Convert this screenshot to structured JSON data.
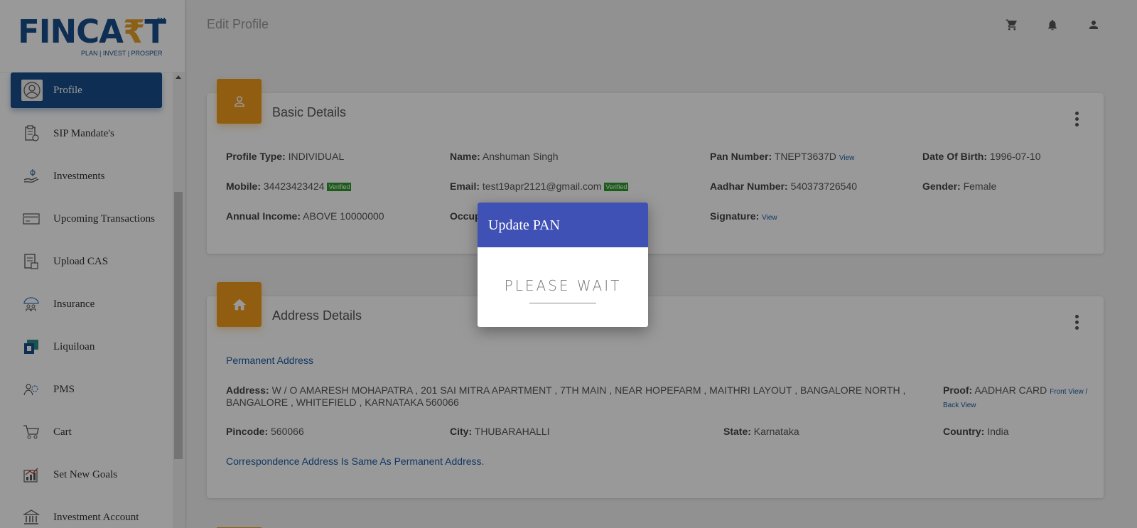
{
  "brand": {
    "name_pre": "FINCA",
    "name_rupee": "₹",
    "name_post": "T",
    "tm": "TM",
    "tagline": "PLAN | INVEST | PROSPER"
  },
  "sidebar": {
    "items": [
      {
        "label": "Profile",
        "icon": "user-circle-icon",
        "active": true
      },
      {
        "label": "SIP Mandate's",
        "icon": "clipboard-icon"
      },
      {
        "label": "Investments",
        "icon": "hand-money-icon"
      },
      {
        "label": "Upcoming Transactions",
        "icon": "card-icon"
      },
      {
        "label": "Upload CAS",
        "icon": "document-upload-icon"
      },
      {
        "label": "Insurance",
        "icon": "umbrella-family-icon"
      },
      {
        "label": "Liquiloan",
        "icon": "liquiloan-icon"
      },
      {
        "label": "PMS",
        "icon": "people-gear-icon"
      },
      {
        "label": "Cart",
        "icon": "cart-icon"
      },
      {
        "label": "Set New Goals",
        "icon": "goal-chart-icon"
      },
      {
        "label": "Investment Account",
        "icon": "bank-icon"
      }
    ]
  },
  "header": {
    "title": "Edit Profile"
  },
  "basic": {
    "title": "Basic Details",
    "profile_type_label": "Profile Type:",
    "profile_type": "INDIVIDUAL",
    "name_label": "Name:",
    "name": "Anshuman Singh",
    "pan_label": "Pan Number:",
    "pan": "TNEPT3637D",
    "pan_view": "View",
    "dob_label": "Date Of Birth:",
    "dob": "1996-07-10",
    "mobile_label": "Mobile:",
    "mobile": "34423423424",
    "mobile_badge": "Verified",
    "email_label": "Email:",
    "email": "test19apr2121@gmail.com",
    "email_badge": "Verified",
    "aadhar_label": "Aadhar Number:",
    "aadhar": "540373726540",
    "gender_label": "Gender:",
    "gender": "Female",
    "income_label": "Annual Income:",
    "income": "ABOVE 10000000",
    "occupation_label": "Occup",
    "signature_label": "Signature:",
    "signature_view": "View"
  },
  "address": {
    "title": "Address Details",
    "permanent_heading": "Permanent Address",
    "address_label": "Address:",
    "address": "W / O AMARESH MOHAPATRA , 201 SAI MITRA APARTMENT , 7TH MAIN , NEAR HOPEFARM , MAITHRI LAYOUT , BANGALORE NORTH , BANGALORE , WHITEFIELD , KARNATAKA 560066",
    "proof_label": "Proof:",
    "proof": "AADHAR CARD",
    "front_view": "Front View /",
    "back_view": "Back View",
    "pincode_label": "Pincode:",
    "pincode": "560066",
    "city_label": "City:",
    "city": "THUBARAHALLI",
    "state_label": "State:",
    "state": "Karnataka",
    "country_label": "Country:",
    "country": "India",
    "correspondence_note": "Correspondence Address Is Same As Permanent Address."
  },
  "modal": {
    "title": "Update PAN",
    "message": "PLEASE WAIT"
  },
  "colors": {
    "brand": "#1a4d8c",
    "accent": "#f29b1d",
    "modal_header": "#3f51b5",
    "verified": "#2e9a2e"
  }
}
